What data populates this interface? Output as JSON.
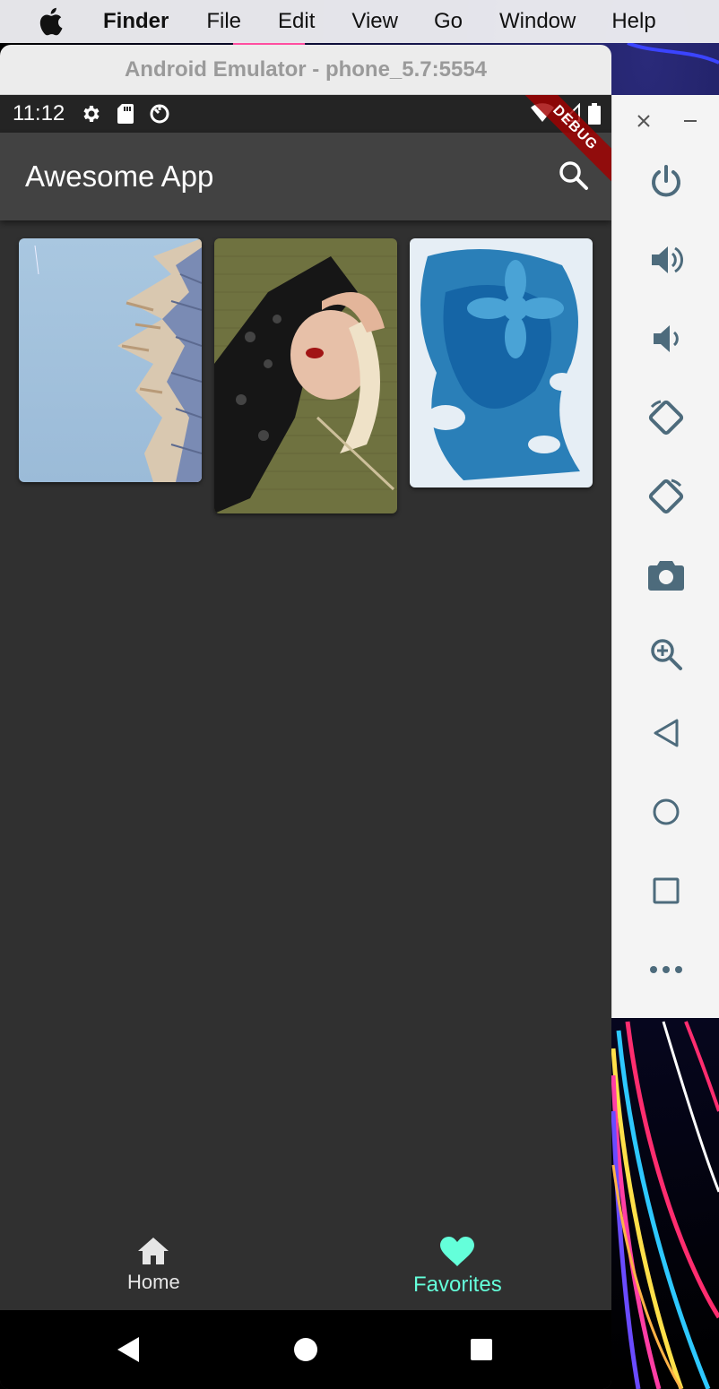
{
  "menubar": {
    "app_name": "Finder",
    "items": [
      "File",
      "Edit",
      "View",
      "Go",
      "Window",
      "Help"
    ]
  },
  "emulator": {
    "window_title": "Android Emulator - phone_5.7:5554"
  },
  "statusbar": {
    "time": "11:12"
  },
  "app": {
    "title": "Awesome App",
    "debug_banner": "DEBUG"
  },
  "bottom_nav": {
    "home_label": "Home",
    "favorites_label": "Favorites",
    "active_color": "#64ffda"
  },
  "toolbar": {
    "buttons": [
      "power-icon",
      "volume-up-icon",
      "volume-down-icon",
      "rotate-left-icon",
      "rotate-right-icon",
      "camera-icon",
      "zoom-icon",
      "back-icon",
      "home-icon",
      "overview-icon",
      "more-icon"
    ]
  }
}
